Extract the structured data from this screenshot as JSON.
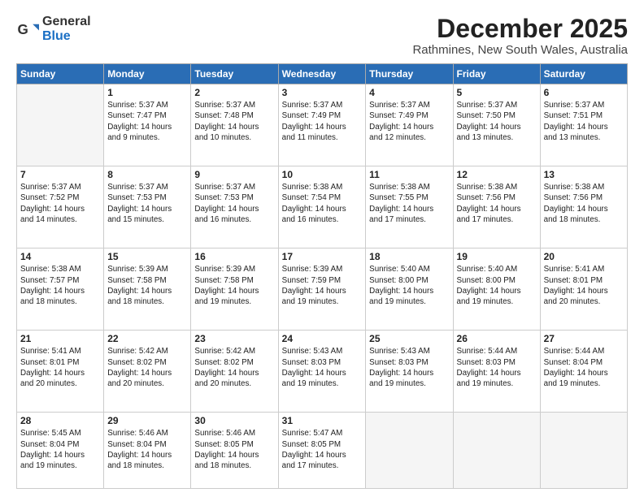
{
  "header": {
    "logo_general": "General",
    "logo_blue": "Blue",
    "month_title": "December 2025",
    "subtitle": "Rathmines, New South Wales, Australia"
  },
  "days_of_week": [
    "Sunday",
    "Monday",
    "Tuesday",
    "Wednesday",
    "Thursday",
    "Friday",
    "Saturday"
  ],
  "weeks": [
    [
      {
        "day": "",
        "text": ""
      },
      {
        "day": "1",
        "text": "Sunrise: 5:37 AM\nSunset: 7:47 PM\nDaylight: 14 hours\nand 9 minutes."
      },
      {
        "day": "2",
        "text": "Sunrise: 5:37 AM\nSunset: 7:48 PM\nDaylight: 14 hours\nand 10 minutes."
      },
      {
        "day": "3",
        "text": "Sunrise: 5:37 AM\nSunset: 7:49 PM\nDaylight: 14 hours\nand 11 minutes."
      },
      {
        "day": "4",
        "text": "Sunrise: 5:37 AM\nSunset: 7:49 PM\nDaylight: 14 hours\nand 12 minutes."
      },
      {
        "day": "5",
        "text": "Sunrise: 5:37 AM\nSunset: 7:50 PM\nDaylight: 14 hours\nand 13 minutes."
      },
      {
        "day": "6",
        "text": "Sunrise: 5:37 AM\nSunset: 7:51 PM\nDaylight: 14 hours\nand 13 minutes."
      }
    ],
    [
      {
        "day": "7",
        "text": "Sunrise: 5:37 AM\nSunset: 7:52 PM\nDaylight: 14 hours\nand 14 minutes."
      },
      {
        "day": "8",
        "text": "Sunrise: 5:37 AM\nSunset: 7:53 PM\nDaylight: 14 hours\nand 15 minutes."
      },
      {
        "day": "9",
        "text": "Sunrise: 5:37 AM\nSunset: 7:53 PM\nDaylight: 14 hours\nand 16 minutes."
      },
      {
        "day": "10",
        "text": "Sunrise: 5:38 AM\nSunset: 7:54 PM\nDaylight: 14 hours\nand 16 minutes."
      },
      {
        "day": "11",
        "text": "Sunrise: 5:38 AM\nSunset: 7:55 PM\nDaylight: 14 hours\nand 17 minutes."
      },
      {
        "day": "12",
        "text": "Sunrise: 5:38 AM\nSunset: 7:56 PM\nDaylight: 14 hours\nand 17 minutes."
      },
      {
        "day": "13",
        "text": "Sunrise: 5:38 AM\nSunset: 7:56 PM\nDaylight: 14 hours\nand 18 minutes."
      }
    ],
    [
      {
        "day": "14",
        "text": "Sunrise: 5:38 AM\nSunset: 7:57 PM\nDaylight: 14 hours\nand 18 minutes."
      },
      {
        "day": "15",
        "text": "Sunrise: 5:39 AM\nSunset: 7:58 PM\nDaylight: 14 hours\nand 18 minutes."
      },
      {
        "day": "16",
        "text": "Sunrise: 5:39 AM\nSunset: 7:58 PM\nDaylight: 14 hours\nand 19 minutes."
      },
      {
        "day": "17",
        "text": "Sunrise: 5:39 AM\nSunset: 7:59 PM\nDaylight: 14 hours\nand 19 minutes."
      },
      {
        "day": "18",
        "text": "Sunrise: 5:40 AM\nSunset: 8:00 PM\nDaylight: 14 hours\nand 19 minutes."
      },
      {
        "day": "19",
        "text": "Sunrise: 5:40 AM\nSunset: 8:00 PM\nDaylight: 14 hours\nand 19 minutes."
      },
      {
        "day": "20",
        "text": "Sunrise: 5:41 AM\nSunset: 8:01 PM\nDaylight: 14 hours\nand 20 minutes."
      }
    ],
    [
      {
        "day": "21",
        "text": "Sunrise: 5:41 AM\nSunset: 8:01 PM\nDaylight: 14 hours\nand 20 minutes."
      },
      {
        "day": "22",
        "text": "Sunrise: 5:42 AM\nSunset: 8:02 PM\nDaylight: 14 hours\nand 20 minutes."
      },
      {
        "day": "23",
        "text": "Sunrise: 5:42 AM\nSunset: 8:02 PM\nDaylight: 14 hours\nand 20 minutes."
      },
      {
        "day": "24",
        "text": "Sunrise: 5:43 AM\nSunset: 8:03 PM\nDaylight: 14 hours\nand 19 minutes."
      },
      {
        "day": "25",
        "text": "Sunrise: 5:43 AM\nSunset: 8:03 PM\nDaylight: 14 hours\nand 19 minutes."
      },
      {
        "day": "26",
        "text": "Sunrise: 5:44 AM\nSunset: 8:03 PM\nDaylight: 14 hours\nand 19 minutes."
      },
      {
        "day": "27",
        "text": "Sunrise: 5:44 AM\nSunset: 8:04 PM\nDaylight: 14 hours\nand 19 minutes."
      }
    ],
    [
      {
        "day": "28",
        "text": "Sunrise: 5:45 AM\nSunset: 8:04 PM\nDaylight: 14 hours\nand 19 minutes."
      },
      {
        "day": "29",
        "text": "Sunrise: 5:46 AM\nSunset: 8:04 PM\nDaylight: 14 hours\nand 18 minutes."
      },
      {
        "day": "30",
        "text": "Sunrise: 5:46 AM\nSunset: 8:05 PM\nDaylight: 14 hours\nand 18 minutes."
      },
      {
        "day": "31",
        "text": "Sunrise: 5:47 AM\nSunset: 8:05 PM\nDaylight: 14 hours\nand 17 minutes."
      },
      {
        "day": "",
        "text": ""
      },
      {
        "day": "",
        "text": ""
      },
      {
        "day": "",
        "text": ""
      }
    ]
  ]
}
